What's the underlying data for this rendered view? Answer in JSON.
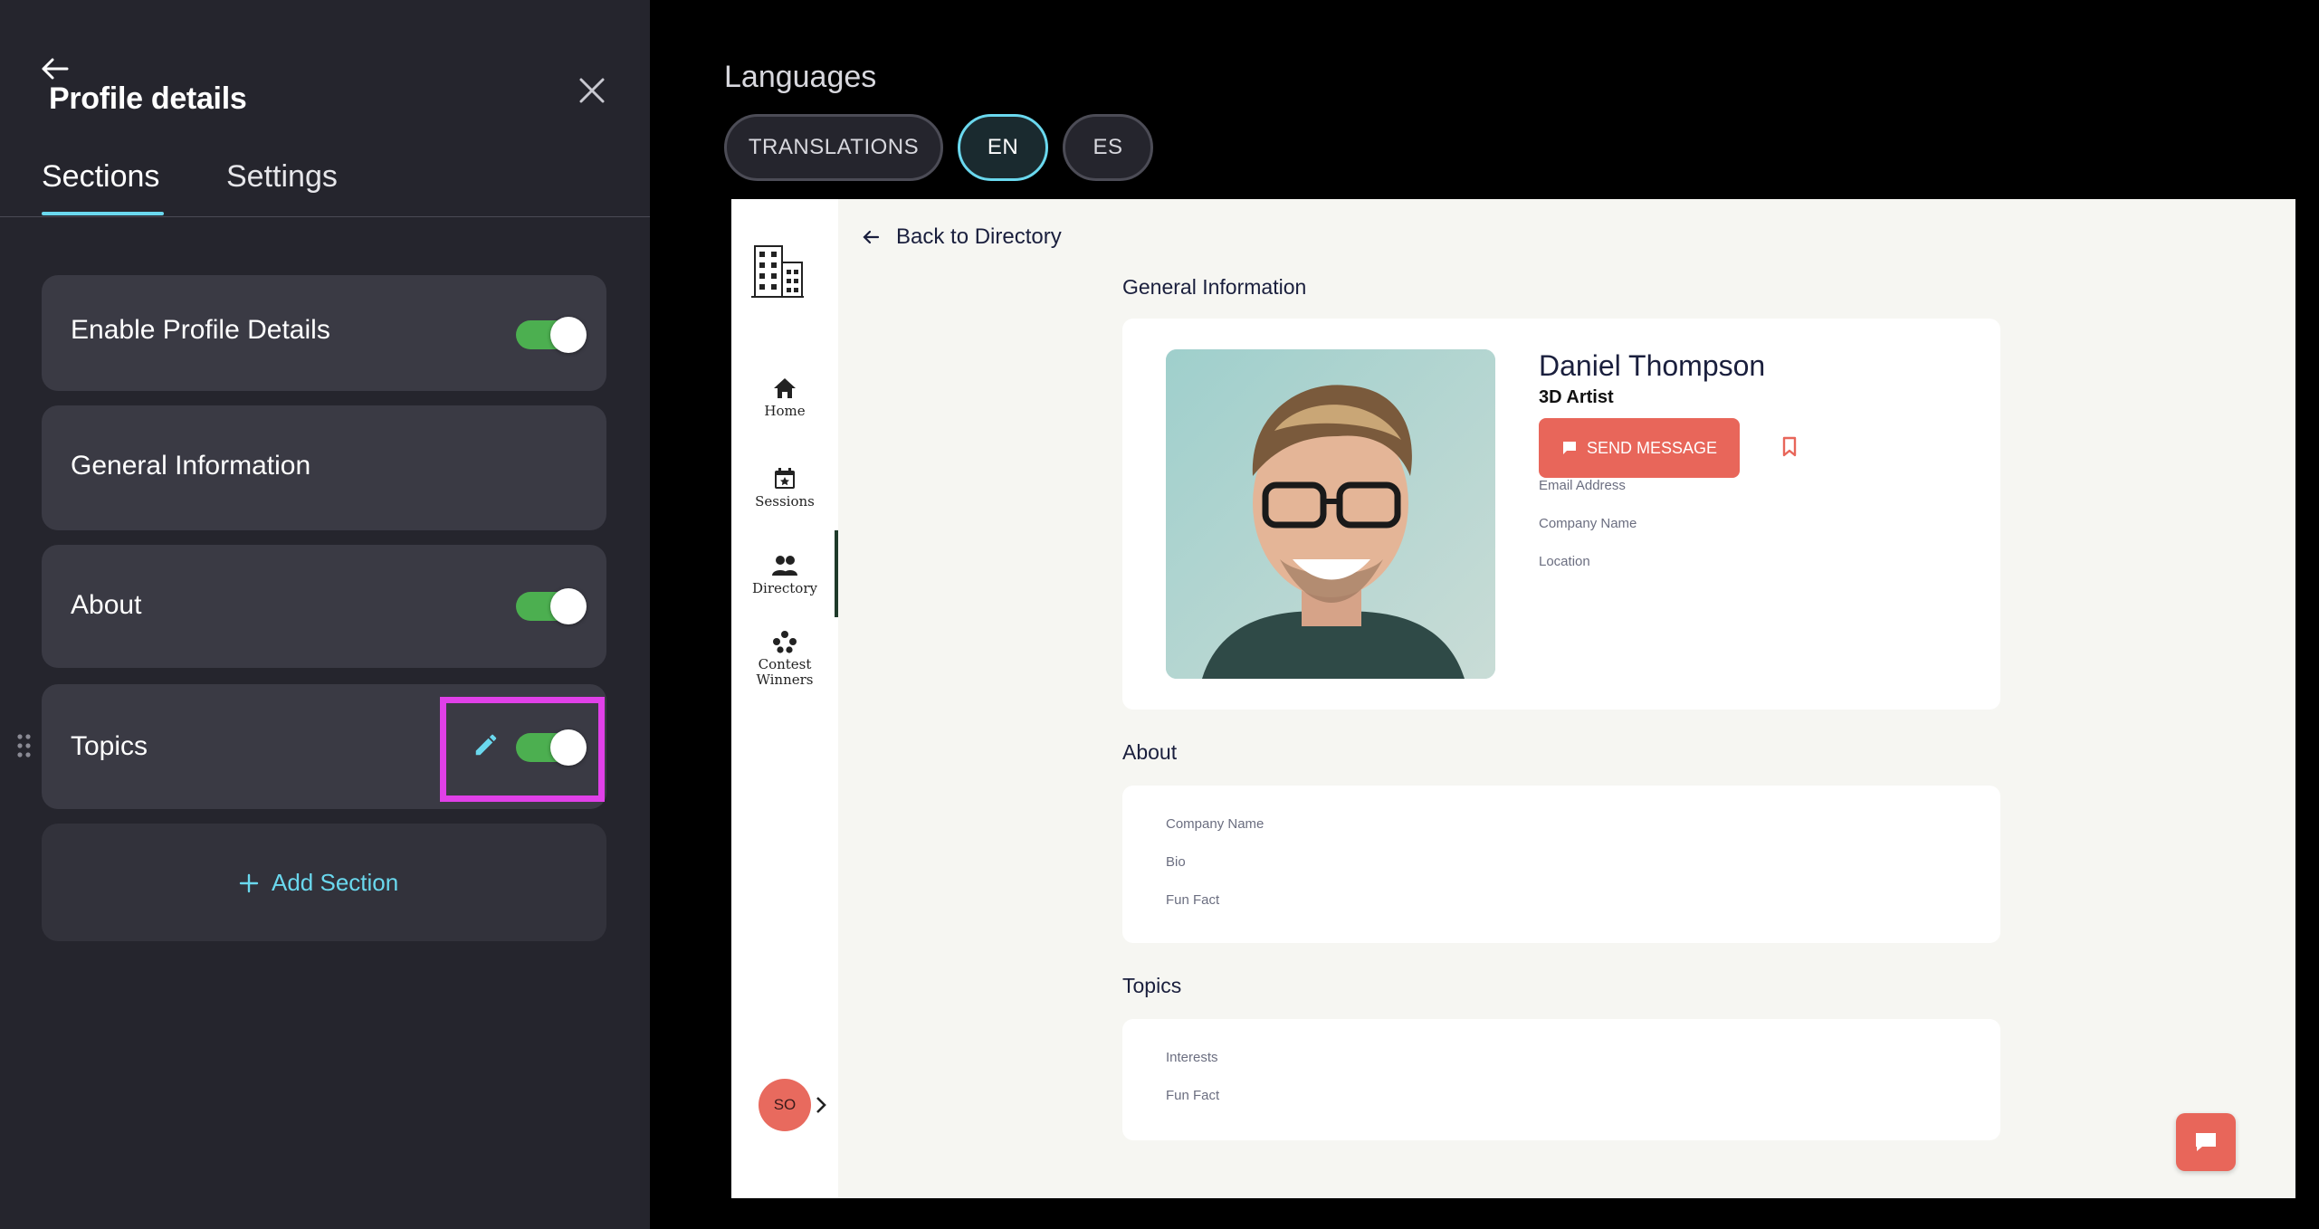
{
  "panel": {
    "title": "Profile details",
    "tabs": [
      {
        "label": "Sections",
        "active": true
      },
      {
        "label": "Settings",
        "active": false
      }
    ],
    "sections": [
      {
        "label": "Enable Profile Details",
        "toggle": true
      },
      {
        "label": "General Information",
        "toggle": null
      },
      {
        "label": "About",
        "toggle": true
      },
      {
        "label": "Topics",
        "toggle": true,
        "editable": true
      }
    ],
    "add_section_label": "Add Section"
  },
  "languages": {
    "title": "Languages",
    "buttons": [
      "TRANSLATIONS",
      "EN",
      "ES"
    ],
    "selected": "EN"
  },
  "preview": {
    "nav": [
      {
        "label": "Home",
        "icon": "home-icon"
      },
      {
        "label": "Sessions",
        "icon": "calendar-star-icon"
      },
      {
        "label": "Directory",
        "icon": "people-icon",
        "active": true
      },
      {
        "label": "Contest Winners",
        "icon": "dots-cluster-icon",
        "lines": [
          "Contest",
          "Winners"
        ]
      }
    ],
    "avatar_initials": "SO",
    "back_label": "Back to Directory",
    "general": {
      "heading": "General Information",
      "name": "Daniel Thompson",
      "title": "3D Artist",
      "send_label": "SEND MESSAGE",
      "fields": [
        "Email Address",
        "Company Name",
        "Location"
      ]
    },
    "about": {
      "heading": "About",
      "fields": [
        "Company Name",
        "Bio",
        "Fun Fact"
      ]
    },
    "topics": {
      "heading": "Topics",
      "fields": [
        "Interests",
        "Fun Fact"
      ]
    }
  },
  "colors": {
    "panel_bg": "#25252d",
    "card_bg": "#3a3a44",
    "accent": "#6ad8ee",
    "toggle_on": "#4caf50",
    "highlight": "#e040e8",
    "brand_red": "#e8665a"
  }
}
